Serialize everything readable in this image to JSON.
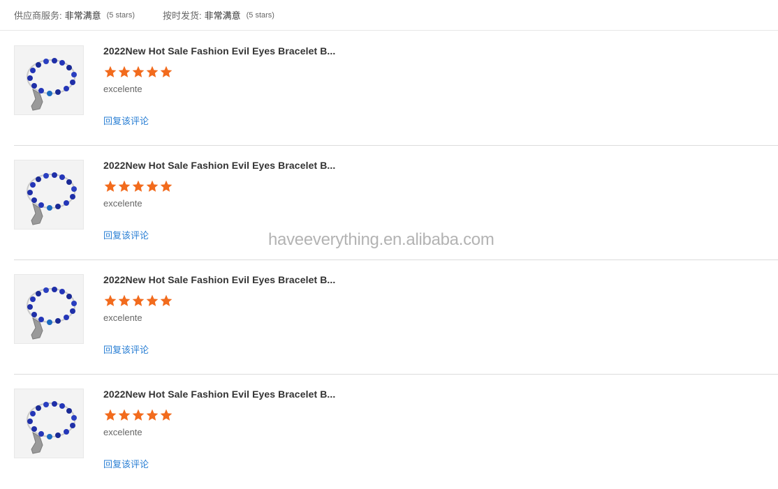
{
  "header": {
    "supplier_service_label": "供应商服务:",
    "supplier_service_value": "非常满意",
    "supplier_service_note": "(5 stars)",
    "ontime_label": "按时发货:",
    "ontime_value": "非常满意",
    "ontime_note": "(5 stars)"
  },
  "reviews": [
    {
      "title": "2022New Hot Sale Fashion Evil Eyes Bracelet B...",
      "rating": 5,
      "text": "excelente",
      "reply_label": "回复该评论"
    },
    {
      "title": "2022New Hot Sale Fashion Evil Eyes Bracelet B...",
      "rating": 5,
      "text": "excelente",
      "reply_label": "回复该评论"
    },
    {
      "title": "2022New Hot Sale Fashion Evil Eyes Bracelet B...",
      "rating": 5,
      "text": "excelente",
      "reply_label": "回复该评论"
    },
    {
      "title": "2022New Hot Sale Fashion Evil Eyes Bracelet B...",
      "rating": 5,
      "text": "excelente",
      "reply_label": "回复该评论"
    }
  ],
  "watermark": "haveeverything.en.alibaba.com",
  "colors": {
    "star": "#f26b1d",
    "link": "#2a7fd4"
  }
}
